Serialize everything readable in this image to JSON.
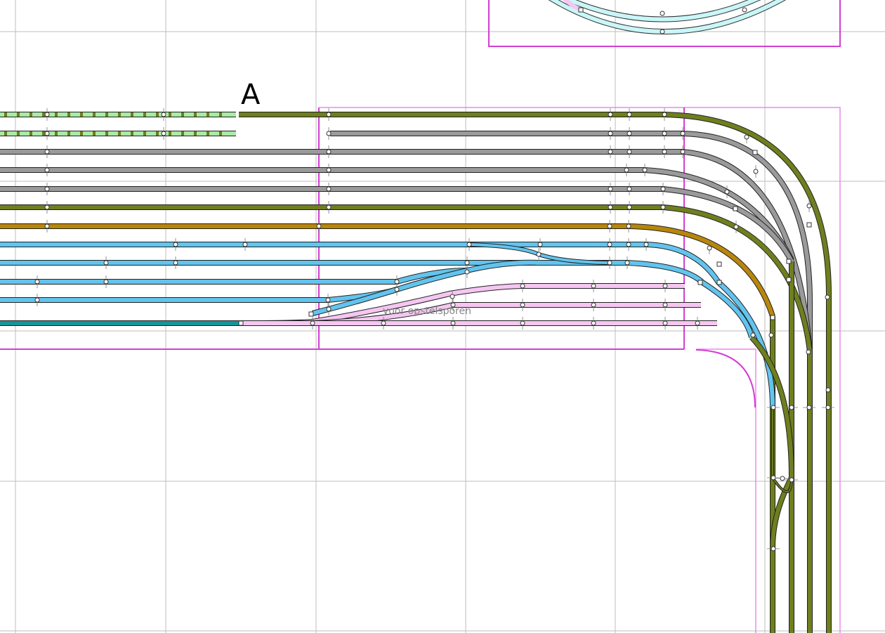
{
  "labels": {
    "section": "A",
    "yard": "voor opstelsporen"
  },
  "colors": {
    "grid": "#bdbdbd",
    "module_border": "#d23ed2",
    "module_border_light": "#ee88ee",
    "olive": "#6e7f1e",
    "grey": "#9a9a9a",
    "amber": "#b8860b",
    "sky": "#62c4ee",
    "pink": "#f6c6f2",
    "teal": "#12979a",
    "lightgreen": "#a8eaa6",
    "cyan_light": "#c9f6f8"
  },
  "tracks": {
    "olive_count": 6,
    "grey_count": 4,
    "amber_count": 1,
    "sky_count": 4,
    "pink_count": 3,
    "teal_count": 1,
    "lightgreen_count": 2
  }
}
